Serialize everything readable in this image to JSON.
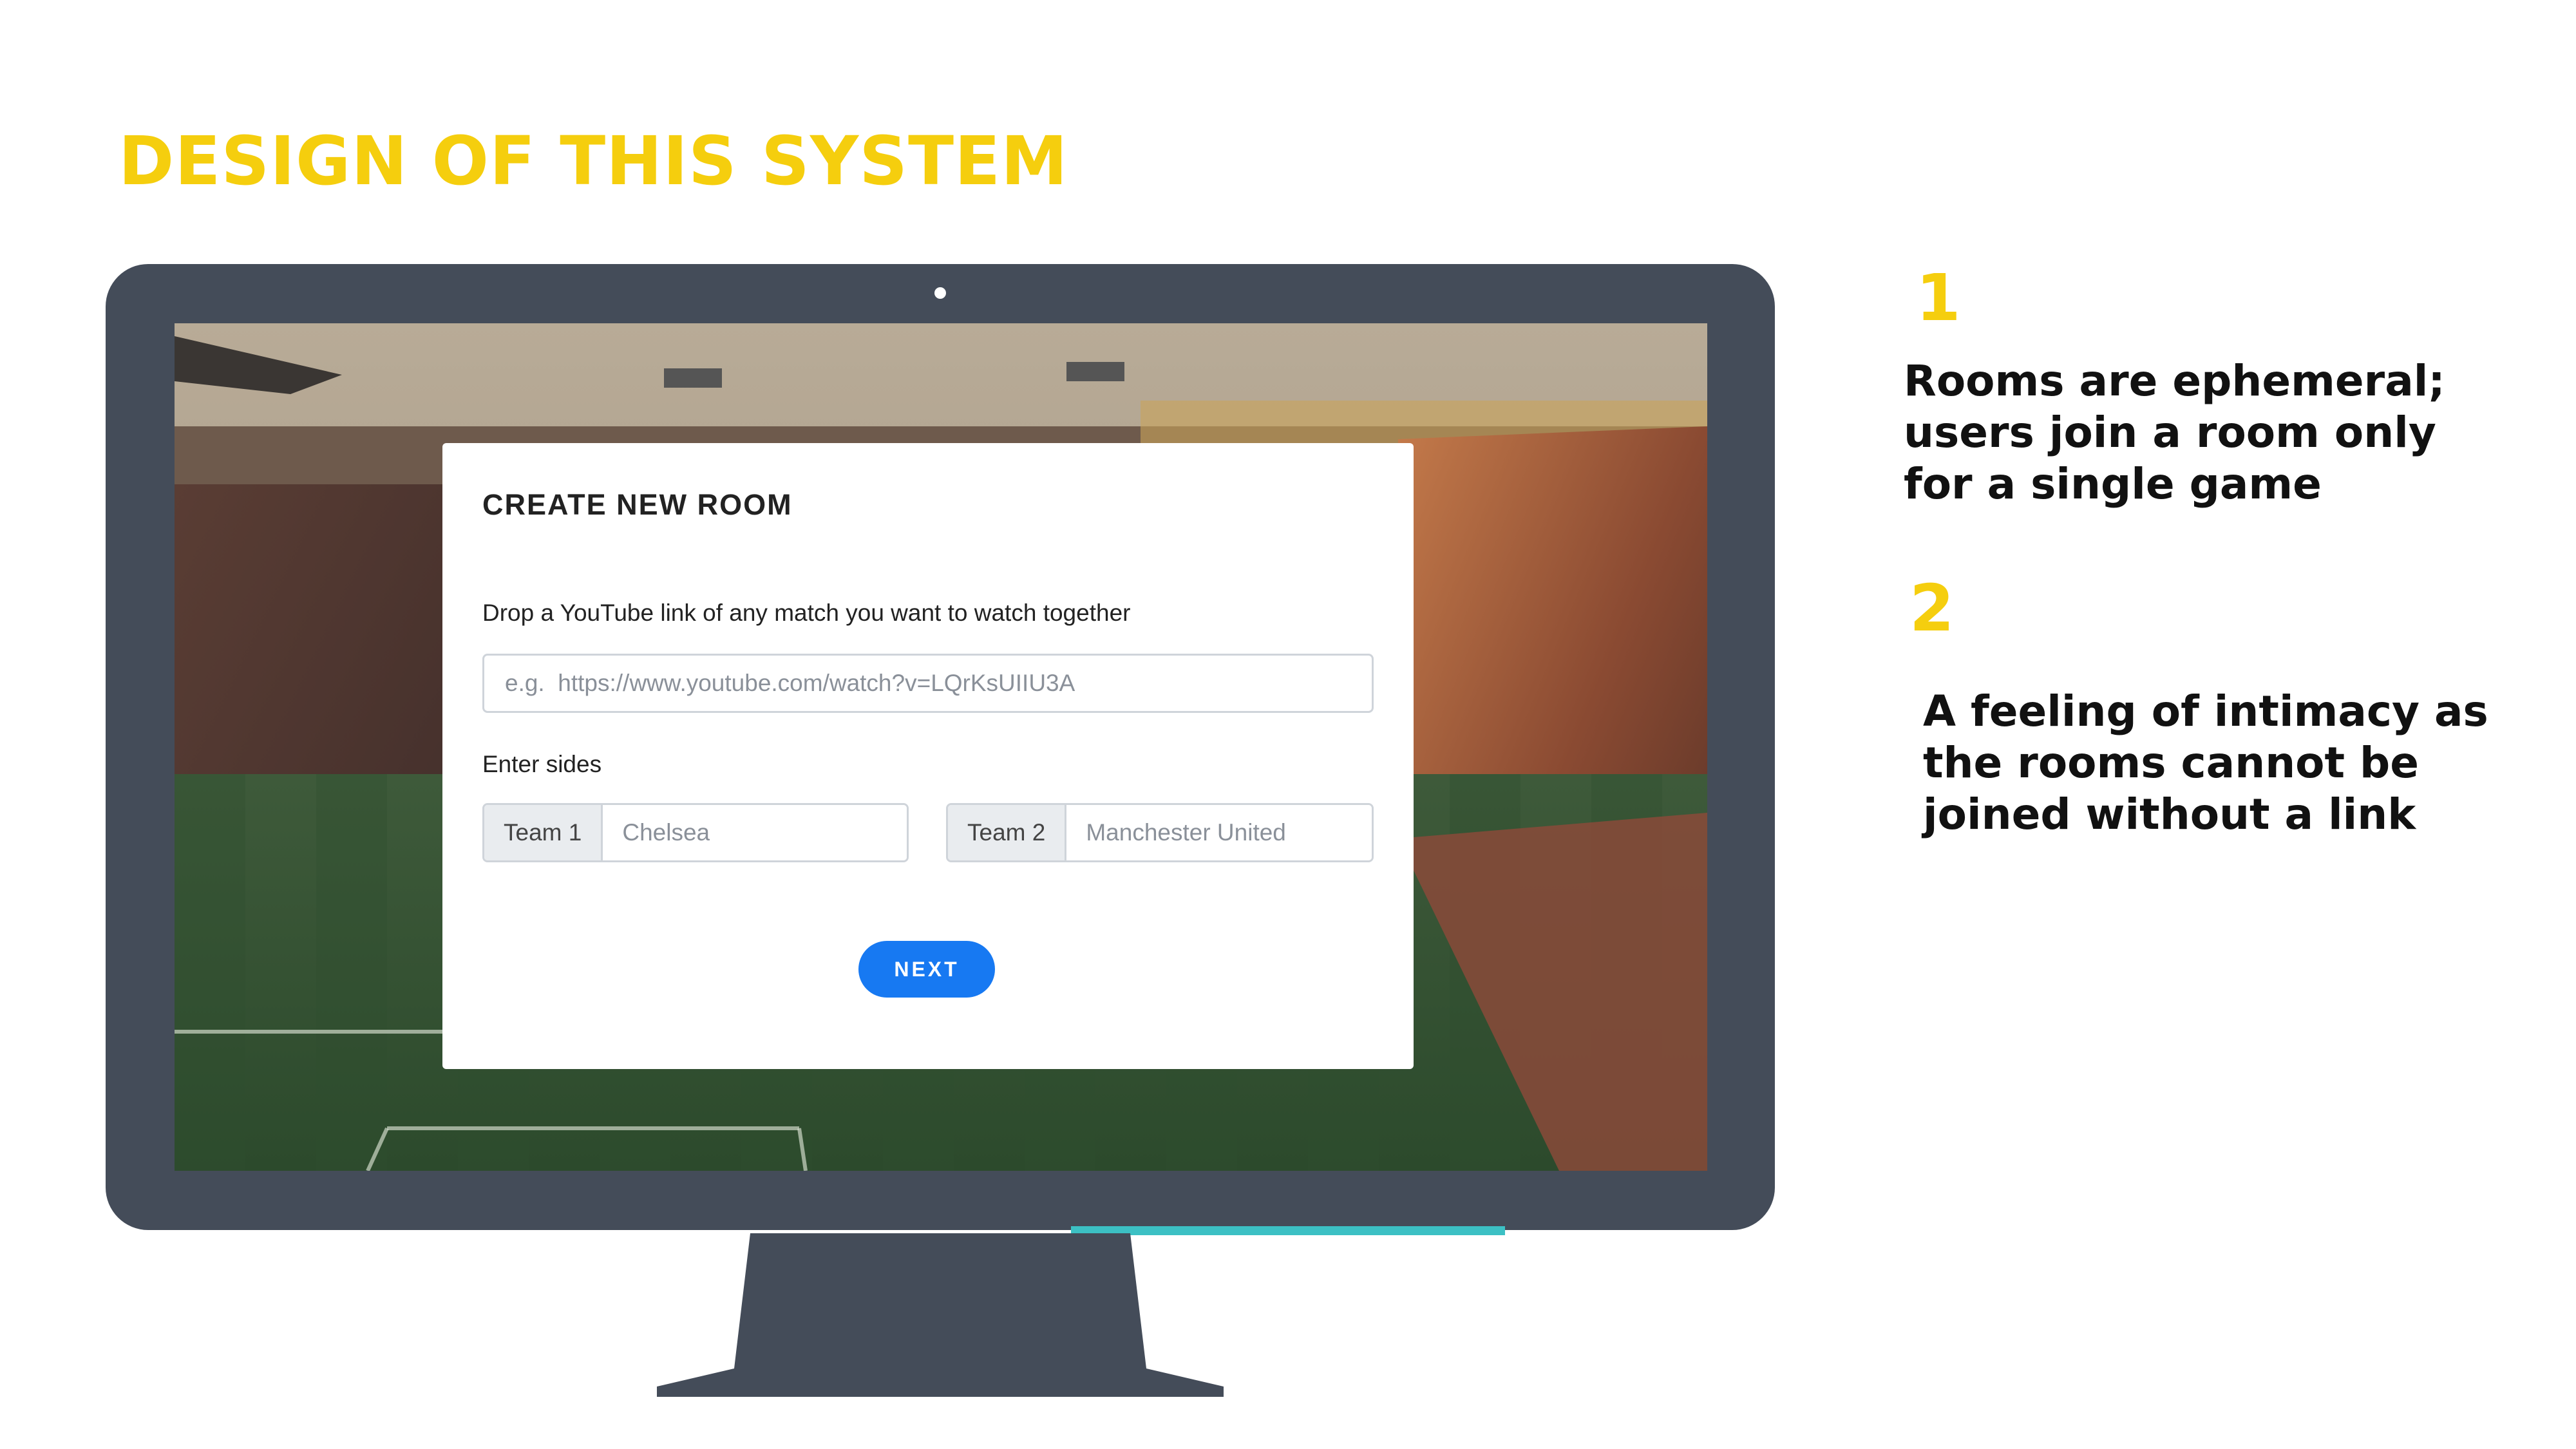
{
  "slide": {
    "title": "DESIGN OF THIS SYSTEM"
  },
  "dialog": {
    "title": "CREATE NEW ROOM",
    "url_prompt": "Drop a YouTube link of any match you want to watch together",
    "url_placeholder": "e.g.  https://www.youtube.com/watch?v=LQrKsUIIU3A",
    "sides_label": "Enter sides",
    "team1_label": "Team 1",
    "team1_placeholder": "Chelsea",
    "team2_label": "Team 2",
    "team2_placeholder": "Manchester United",
    "next_label": "NEXT"
  },
  "points": [
    {
      "number": "1",
      "text": "Rooms are ephemeral; users join a room only for a single game"
    },
    {
      "number": "2",
      "text": "A feeling of intimacy as the rooms cannot be joined without a link"
    }
  ],
  "colors": {
    "accent_yellow": "#F5CE0E",
    "monitor_gray": "#444C59",
    "button_blue": "#1779F2",
    "accent_teal": "#3CC0C4"
  }
}
